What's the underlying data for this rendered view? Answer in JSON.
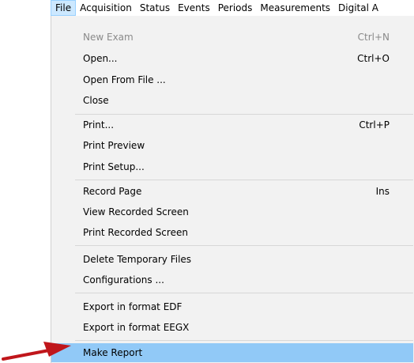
{
  "menubar": {
    "items": [
      "File",
      "Acquisition",
      "Status",
      "Events",
      "Periods",
      "Measurements",
      "Digital A"
    ]
  },
  "file_menu": {
    "items": [
      {
        "label": "New Exam",
        "shortcut": "Ctrl+N"
      },
      {
        "label": "Open...",
        "shortcut": "Ctrl+O"
      },
      {
        "label": "Open From File ...",
        "shortcut": ""
      },
      {
        "label": "Close",
        "shortcut": ""
      },
      {
        "label": "Print...",
        "shortcut": "Ctrl+P"
      },
      {
        "label": "Print Preview",
        "shortcut": ""
      },
      {
        "label": "Print Setup...",
        "shortcut": ""
      },
      {
        "label": "Record Page",
        "shortcut": "Ins"
      },
      {
        "label": "View Recorded Screen",
        "shortcut": ""
      },
      {
        "label": "Print Recorded Screen",
        "shortcut": ""
      },
      {
        "label": "Delete Temporary Files",
        "shortcut": ""
      },
      {
        "label": "Configurations ...",
        "shortcut": ""
      },
      {
        "label": "Export in format EDF",
        "shortcut": ""
      },
      {
        "label": "Export in format EEGX",
        "shortcut": ""
      },
      {
        "label": "Make Report",
        "shortcut": ""
      }
    ]
  },
  "colors": {
    "highlight": "#91c9f7",
    "menu_bg": "#f2f2f2",
    "arrow": "#c0161b",
    "disabled_text": "#8a8a8a"
  }
}
